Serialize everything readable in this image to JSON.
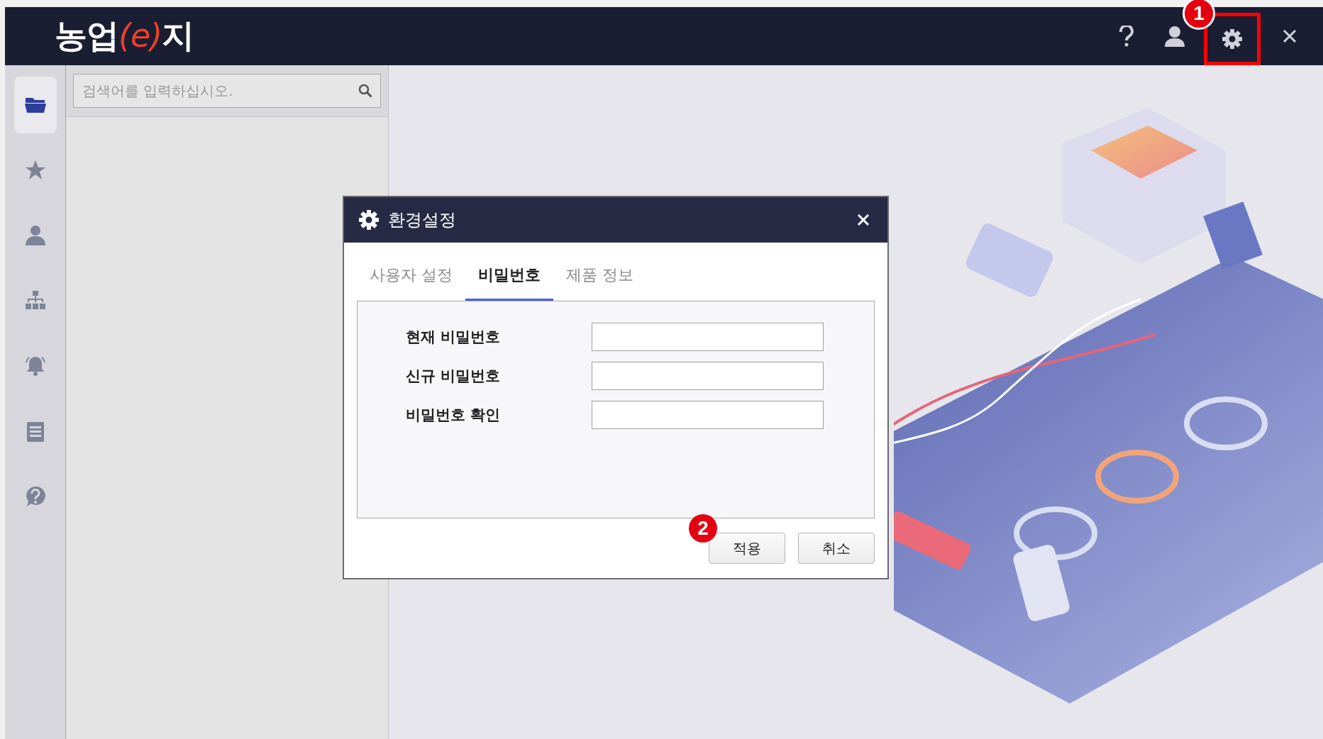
{
  "header": {
    "logo": [
      {
        "text": "농업",
        "kind": "plain"
      },
      {
        "text": "(e)",
        "kind": "accent"
      },
      {
        "text": "지",
        "kind": "plain"
      }
    ],
    "toolbar": [
      {
        "kind": "help",
        "highlighted": false
      },
      {
        "kind": "user",
        "highlighted": false
      },
      {
        "kind": "settings",
        "highlighted": true,
        "callout": "1"
      },
      {
        "kind": "close",
        "highlighted": false
      }
    ]
  },
  "sidebar": {
    "items": [
      {
        "kind": "folder",
        "selected": true
      },
      {
        "kind": "star",
        "selected": false
      },
      {
        "kind": "person",
        "selected": false
      },
      {
        "kind": "org-chart",
        "selected": false
      },
      {
        "kind": "bell",
        "selected": false
      },
      {
        "kind": "clipboard",
        "selected": false
      },
      {
        "kind": "help",
        "selected": false
      }
    ]
  },
  "search": {
    "placeholder": "검색어를 입력하십시오."
  },
  "dialog": {
    "title": "환경설정",
    "tabs": [
      {
        "label": "사용자 설정",
        "selected": false
      },
      {
        "label": "비밀번호",
        "selected": true
      },
      {
        "label": "제품 정보",
        "selected": false
      }
    ],
    "fields": [
      {
        "label": "현재 비밀번호"
      },
      {
        "label": "신규 비밀번호"
      },
      {
        "label": "비밀번호 확인"
      }
    ],
    "buttons": [
      {
        "label": "적용",
        "callout": "2"
      },
      {
        "label": "취소"
      }
    ]
  }
}
